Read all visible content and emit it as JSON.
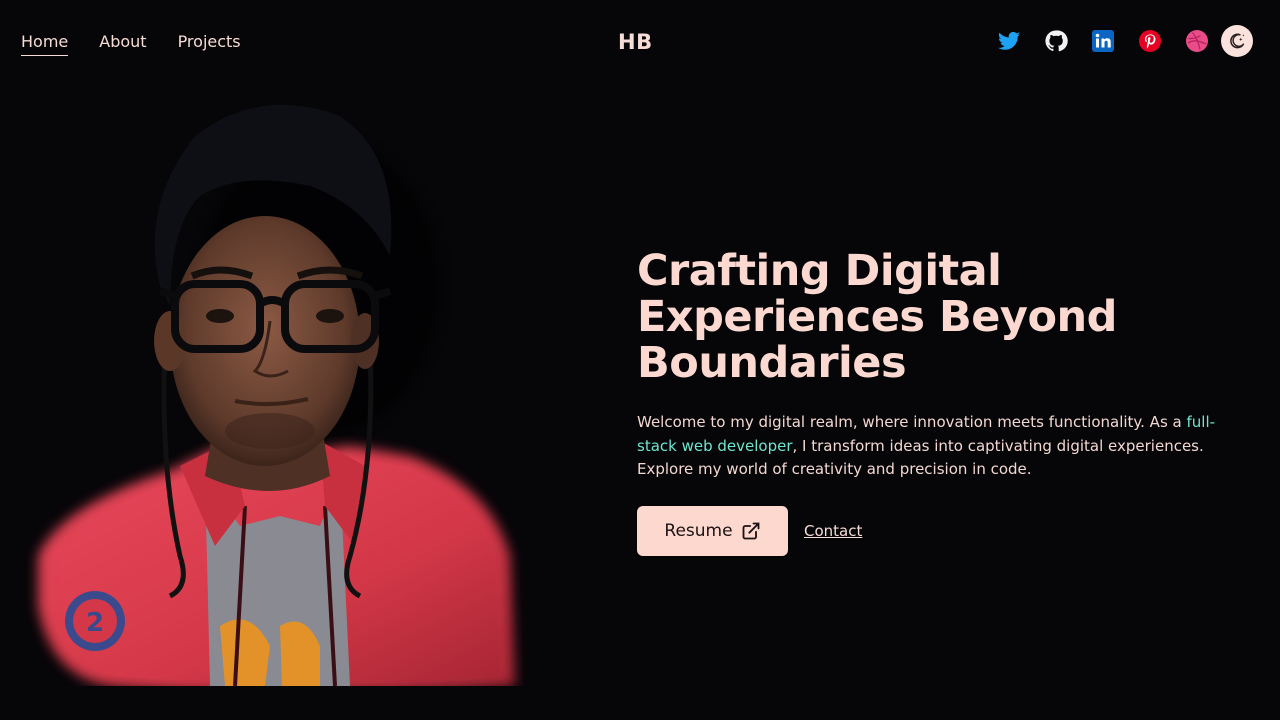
{
  "nav": {
    "links": [
      {
        "label": "Home",
        "active": true
      },
      {
        "label": "About",
        "active": false
      },
      {
        "label": "Projects",
        "active": false
      }
    ],
    "logo": "HB",
    "socials": [
      "twitter-icon",
      "github-icon",
      "linkedin-icon",
      "pinterest-icon",
      "dribbble-icon"
    ],
    "theme_toggle_icon": "moon-stars-icon"
  },
  "hero": {
    "title_lines": [
      "Crafting Digital",
      "Experiences Beyond",
      "Boundaries"
    ],
    "desc_before": "Welcome to my digital realm, where innovation meets functionality. As a ",
    "desc_highlight": "full-stack web developer",
    "desc_after": ", I transform ideas into captivating digital experiences. Explore my world of creativity and precision in code.",
    "resume_label": "Resume",
    "resume_icon": "external-link-icon",
    "contact_label": "Contact"
  },
  "colors": {
    "background": "#060508",
    "text": "#f6dcd6",
    "accent": "#6fe6cf",
    "button_bg": "#fcd8cf",
    "twitter": "#1da1f2",
    "linkedin": "#0a66c2",
    "pinterest": "#e60023",
    "dribbble": "#ea4c89"
  }
}
